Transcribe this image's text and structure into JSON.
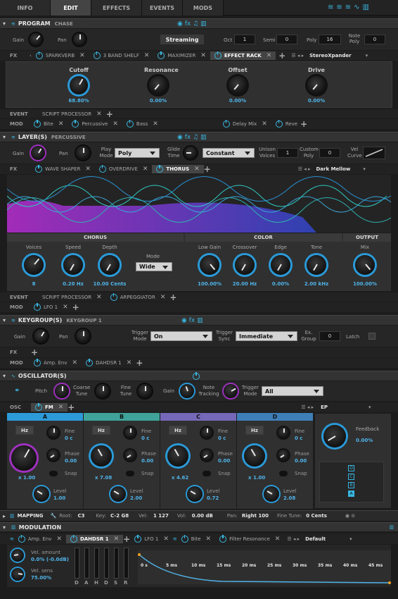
{
  "tabs": [
    "INFO",
    "EDIT",
    "EFFECTS",
    "EVENTS",
    "MODS"
  ],
  "program": {
    "title": "PROGRAM",
    "name": "CHASE",
    "gain": "Gain",
    "pan": "Pan",
    "preset": "Streaming",
    "oct_label": "Oct",
    "oct": "1",
    "semi_label": "Semi",
    "semi": "0",
    "poly_label": "Poly",
    "poly": "16",
    "note_poly_label": "Note Poly",
    "note_poly": "0",
    "fx_label": "FX",
    "fx_chips": [
      "SPARKVERB",
      "3 BAND SHELF",
      "MAXIMIZER",
      "EFFECT RACK"
    ],
    "fx_preset": "StereoXpander",
    "knobs": [
      {
        "label": "Cutoff",
        "value": "68.80%"
      },
      {
        "label": "Resonance",
        "value": "0.00%"
      },
      {
        "label": "Offset",
        "value": "0.00%"
      },
      {
        "label": "Drive",
        "value": "0.00%"
      }
    ],
    "event_label": "EVENT",
    "event_chips": [
      "SCRIPT PROCESSOR"
    ],
    "mod_label": "MOD",
    "mod_chips": [
      "Bite",
      "Percussive",
      "Bass",
      "Delay Mix",
      "Reve"
    ]
  },
  "layer": {
    "title": "LAYER(S)",
    "name": "PERCUSSIVE",
    "gain": "Gain",
    "pan": "Pan",
    "play_mode_label": "Play Mode",
    "play_mode": "Poly",
    "glide_label": "Glide Time",
    "glide": "Constant",
    "unison_label": "Unison Voices",
    "unison": "1",
    "custom_poly_label": "Custom Poly",
    "custom_poly": "0",
    "vel_curve_label": "Vel Curve",
    "fx_label": "FX",
    "fx_chips": [
      "WAVE SHAPER",
      "OVERDRIVE",
      "THORUS"
    ],
    "fx_preset": "Dark Mellow",
    "sections": [
      "CHORUS",
      "COLOR",
      "OUTPUT"
    ],
    "knobs": [
      {
        "label": "Voices",
        "value": "8"
      },
      {
        "label": "Speed",
        "value": "0.20 Hz"
      },
      {
        "label": "Depth",
        "value": "10.00 Cents"
      },
      {
        "label": "Low Gain",
        "value": "100.00%"
      },
      {
        "label": "Crossover",
        "value": "20.00 Hz"
      },
      {
        "label": "Edge",
        "value": "0.00%"
      },
      {
        "label": "Tone",
        "value": "2.00 kHz"
      },
      {
        "label": "Mix",
        "value": "100.00%"
      }
    ],
    "mode_label": "Mode",
    "mode": "Wide",
    "event_label": "EVENT",
    "event_chips": [
      "SCRIPT PROCESSOR",
      "ARPEGGIATOR"
    ],
    "mod_label": "MOD",
    "mod_chips": [
      "LFO 1"
    ]
  },
  "keygroup": {
    "title": "KEYGROUP(S)",
    "name": "KEYGROUP 1",
    "gain": "Gain",
    "pan": "Pan",
    "trigger_mode_label": "Trigger Mode",
    "trigger_mode": "On",
    "trigger_sync_label": "Trigger Sync",
    "trigger_sync": "Immediate",
    "ex_group_label": "Ex. Group",
    "ex_group": "0",
    "latch": "Latch",
    "fx_label": "FX",
    "mod_label": "MOD",
    "mod_chips": [
      "Amp. Env",
      "DAHDSR 1"
    ]
  },
  "osc": {
    "title": "OSCILLATOR(S)",
    "pitch": "Pitch",
    "coarse": "Coarse Tune",
    "fine": "Fine Tune",
    "gain": "Gain",
    "note_tracking": "Note Tracking",
    "trigger_mode_label": "Trigger Mode",
    "trigger_mode": "All",
    "osc_label": "OSC",
    "osc_chip": "FM",
    "preset": "EP",
    "ops": [
      {
        "name": "A",
        "ratio": "x 1.00",
        "fine": "0 c",
        "phase": "0.00",
        "level": "1.00"
      },
      {
        "name": "B",
        "ratio": "x 7.08",
        "fine": "0 c",
        "phase": "0.00",
        "level": "2.00"
      },
      {
        "name": "C",
        "ratio": "x 4.62",
        "fine": "0 c",
        "phase": "0.00",
        "level": "0.72"
      },
      {
        "name": "D",
        "ratio": "x 1.00",
        "fine": "0 c",
        "phase": "0.00",
        "level": "2.08"
      }
    ],
    "hz": "Hz",
    "fine_label": "Fine",
    "phase_label": "Phase",
    "snap_label": "Snap",
    "level_label": "Level",
    "feedback_label": "Feedback",
    "feedback": "0.00%",
    "algo": [
      "D",
      "C",
      "B",
      "A"
    ]
  },
  "mapping": {
    "title": "MAPPING",
    "root_label": "Root:",
    "root": "C3",
    "key_label": "Key:",
    "key": "C-2 G8",
    "vel_label": "Vel:",
    "vel": "1 127",
    "vol_label": "Vol:",
    "vol": "0.00 dB",
    "pan_label": "Pan:",
    "pan": "Right 100",
    "fine_label": "Fine Tune:",
    "fine": "0 Cents"
  },
  "modulation": {
    "title": "MODULATION",
    "chips": [
      "Amp. Env",
      "DAHDSR 1",
      "LFO 1",
      "Bite",
      "Filter Resonance"
    ],
    "preset": "Default",
    "vel_amount_label": "Vel. amount",
    "vel_amount": "0.0% (-0.0dB)",
    "vel_sens_label": "Vel. sens",
    "vel_sens": "75.00%",
    "sliders": [
      "D",
      "A",
      "H",
      "D",
      "S",
      "R"
    ],
    "time_labels": [
      "0 s",
      "5 ms",
      "10 ms",
      "15 ms",
      "20 ms",
      "25 ms",
      "30 ms",
      "35 ms",
      "40 ms",
      "45 ms"
    ]
  },
  "colors": {
    "accent": "#38b6e0",
    "waveform": "#7a2fd0"
  }
}
